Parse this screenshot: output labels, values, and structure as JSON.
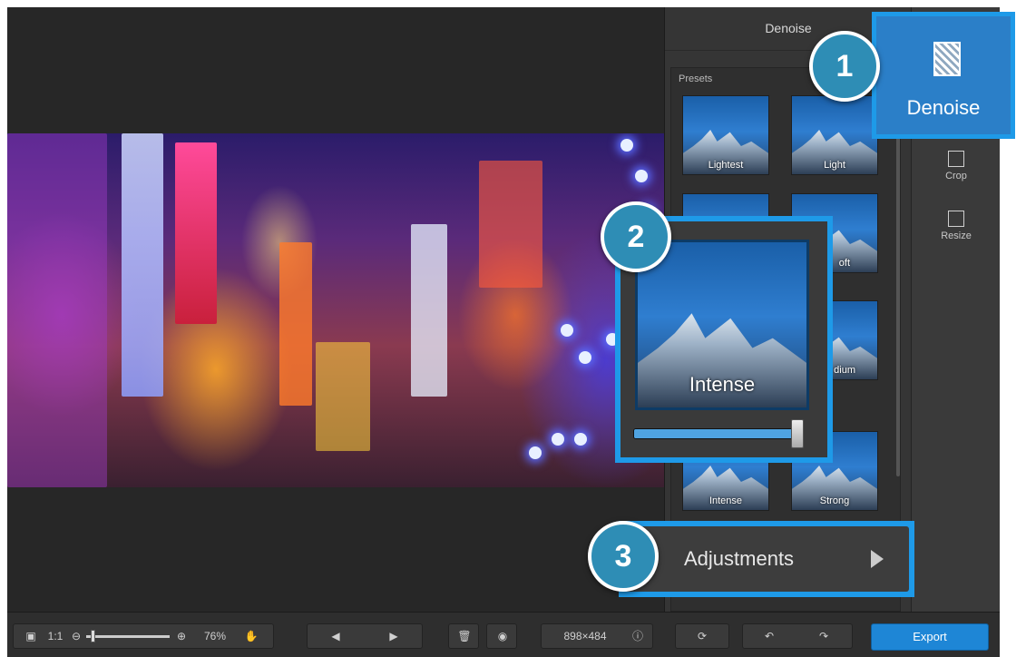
{
  "panel": {
    "title": "Denoise",
    "presets_label": "Presets",
    "presets": [
      {
        "label": "Lightest"
      },
      {
        "label": "Light"
      },
      {
        "label": ""
      },
      {
        "label": "oft"
      },
      {
        "label": ""
      },
      {
        "label": "dium"
      },
      {
        "label": "Intense"
      },
      {
        "label": "Strong"
      }
    ]
  },
  "tools": {
    "denoise_label": "Denoise",
    "crop_label": "Crop",
    "resize_label": "Resize"
  },
  "callouts": {
    "badge1": "1",
    "badge2": "2",
    "badge3": "3",
    "zoom_preset_label": "Intense",
    "slider_level": 1.0,
    "adjustments_label": "Adjustments"
  },
  "toolbar": {
    "ratio_label": "1:1",
    "zoom_percent": "76%",
    "zoom_level": 0.08,
    "image_size": "898×484",
    "export_label": "Export"
  },
  "colors": {
    "accent": "#1e9ae8",
    "badge": "#2e8db5",
    "export": "#1e86d6"
  }
}
